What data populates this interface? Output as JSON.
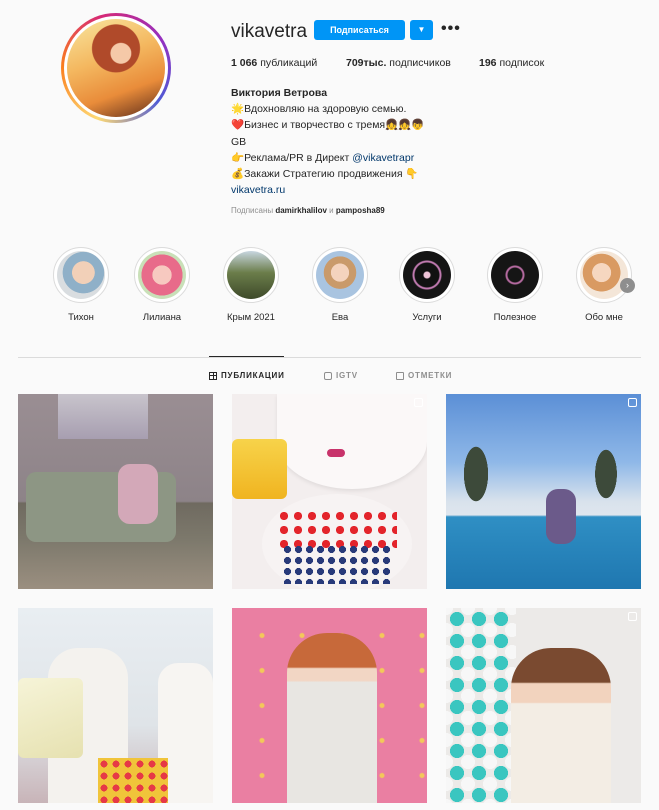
{
  "profile": {
    "username": "vikavetra",
    "follow_label": "Подписаться",
    "more_label": "•••",
    "stats": {
      "posts_value": "1 066",
      "posts_label": " публикаций",
      "followers_value": "709тыс.",
      "followers_label": " подписчиков",
      "following_value": "196",
      "following_label": " подписок"
    },
    "bio": {
      "name": "Виктория Ветрова",
      "line1": "🌟Вдохновляю на здоровую семью.",
      "line2": "❤️Бизнес и творчество с тремя👧👧👦",
      "line3": "GB",
      "line4_prefix": "👉Реклама/PR в Директ ",
      "line4_mention": "@vikavetrapr",
      "line5": "💰Закажи Стратегию продвижения 👇",
      "link": "vikavetra.ru"
    },
    "followed_by_prefix": "Подписаны ",
    "followed_by_user1": "damirkhalilov",
    "followed_by_and": " и ",
    "followed_by_user2": "pamposha89"
  },
  "highlights": [
    {
      "label": "Тихон"
    },
    {
      "label": "Лилиана"
    },
    {
      "label": "Крым 2021"
    },
    {
      "label": "Ева"
    },
    {
      "label": "Услуги"
    },
    {
      "label": "Полезное"
    },
    {
      "label": "Обо мне"
    }
  ],
  "tabs": [
    {
      "label": "ПУБЛИКАЦИИ",
      "icon": "grid-icon",
      "active": true
    },
    {
      "label": "IGTV",
      "icon": "igtv-icon",
      "active": false
    },
    {
      "label": "ОТМЕТКИ",
      "icon": "tag-icon",
      "active": false
    }
  ],
  "colors": {
    "accent": "#0095f6",
    "text": "#262626",
    "muted": "#8e8e8e",
    "link": "#00376b"
  }
}
